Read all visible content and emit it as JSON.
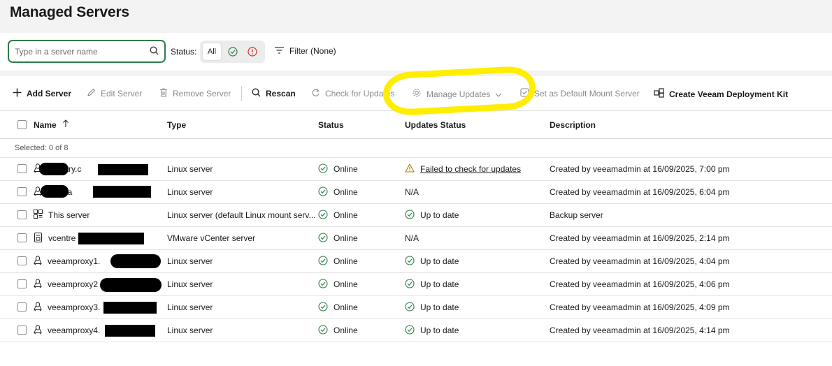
{
  "page_title": "Managed Servers",
  "filter_bar": {
    "search_placeholder": "Type in a server name",
    "status_label": "Status:",
    "status_all": "All",
    "filter_label": "Filter (None)"
  },
  "toolbar": {
    "add_server": "Add Server",
    "edit_server": "Edit Server",
    "remove_server": "Remove Server",
    "rescan": "Rescan",
    "check_updates": "Check for Updates",
    "manage_updates": "Manage Updates",
    "set_default_mount": "Set as Default Mount Server",
    "create_kit": "Create Veeam Deployment Kit"
  },
  "table": {
    "headers": {
      "name": "Name",
      "type": "Type",
      "status": "Status",
      "updates": "Updates Status",
      "description": "Description"
    },
    "selected_text": "Selected:  0 of 8",
    "rows": [
      {
        "icon": "linux-icon",
        "name": "primary.c",
        "type": "Linux server",
        "status": "Online",
        "updates": "Failed to check for updates",
        "updates_icon": "warning-icon",
        "description": "Created by veeamadmin at 16/09/2025, 7:00 pm"
      },
      {
        "icon": "linux-icon",
        "name": "replica",
        "type": "Linux server",
        "status": "Online",
        "updates": "N/A",
        "updates_icon": "",
        "description": "Created by veeamadmin at 16/09/2025, 6:04 pm"
      },
      {
        "icon": "server-grid-icon",
        "name": "This server",
        "type": "Linux server (default Linux mount serv...",
        "status": "Online",
        "updates": "Up to date",
        "updates_icon": "check-icon",
        "description": "Backup server"
      },
      {
        "icon": "vcenter-icon",
        "name": "vcentre",
        "type": "VMware vCenter server",
        "status": "Online",
        "updates": "N/A",
        "updates_icon": "",
        "description": "Created by veeamadmin at 16/09/2025, 2:14 pm"
      },
      {
        "icon": "linux-icon",
        "name": "veeamproxy1.",
        "type": "Linux server",
        "status": "Online",
        "updates": "Up to date",
        "updates_icon": "check-icon",
        "description": "Created by veeamadmin at 16/09/2025, 4:04 pm"
      },
      {
        "icon": "linux-icon",
        "name": "veeamproxy2",
        "type": "Linux server",
        "status": "Online",
        "updates": "Up to date",
        "updates_icon": "check-icon",
        "description": "Created by veeamadmin at 16/09/2025, 4:06 pm"
      },
      {
        "icon": "linux-icon",
        "name": "veeamproxy3.",
        "type": "Linux server",
        "status": "Online",
        "updates": "Up to date",
        "updates_icon": "check-icon",
        "description": "Created by veeamadmin at 16/09/2025, 4:09 pm"
      },
      {
        "icon": "linux-icon",
        "name": "veeamproxy4.",
        "type": "Linux server",
        "status": "Online",
        "updates": "Up to date",
        "updates_icon": "check-icon",
        "description": "Created by veeamadmin at 16/09/2025, 4:14 pm"
      }
    ]
  },
  "colors": {
    "accent_green": "#2e7d4a",
    "error_red": "#d32f2f",
    "warning": "#b07800",
    "highlight": "#ffee00"
  }
}
